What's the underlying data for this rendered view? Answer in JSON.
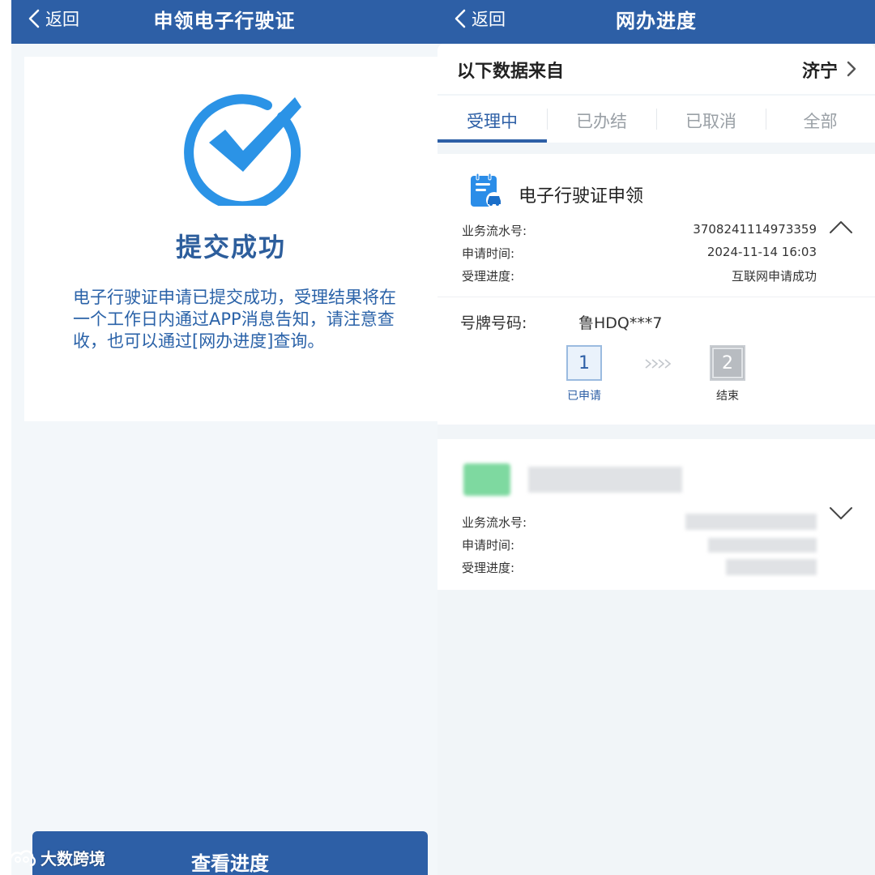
{
  "left": {
    "back_label": "返回",
    "title": "申领电子行驶证",
    "success_title": "提交成功",
    "success_desc": "电子行驶证申请已提交成功，受理结果将在一个工作日内通过APP消息告知，请注意查收，也可以通过[网办进度]查询。",
    "button_label": "查看进度",
    "watermark": "大数跨境"
  },
  "right": {
    "back_label": "返回",
    "title": "网办进度",
    "source_label": "以下数据来自",
    "source_city": "济宁",
    "tabs": [
      {
        "label": "受理中",
        "active": true
      },
      {
        "label": "已办结",
        "active": false
      },
      {
        "label": "已取消",
        "active": false
      },
      {
        "label": "全部",
        "active": false
      }
    ],
    "record": {
      "title": "电子行驶证申领",
      "serial_label": "业务流水号:",
      "serial_value": "3708241114973359",
      "time_label": "申请时间:",
      "time_value": "2024-11-14 16:03",
      "progress_label": "受理进度:",
      "progress_value": "互联网申请成功",
      "plate_label": "号牌号码:",
      "plate_value": "鲁HDQ***7",
      "steps": [
        {
          "number": "1",
          "label": "已申请"
        },
        {
          "number": "2",
          "label": "结束"
        }
      ]
    },
    "record2": {
      "serial_label": "业务流水号:",
      "time_label": "申请时间:",
      "progress_label": "受理进度:"
    }
  },
  "colors": {
    "primary": "#2d5fa6",
    "check_blue": "#2b93e6",
    "page_bg": "#f3f7fa"
  }
}
